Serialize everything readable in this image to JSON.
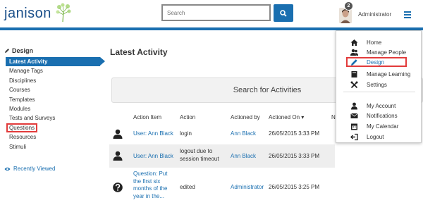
{
  "header": {
    "logo_text": "janison",
    "search_placeholder": "Search",
    "notification_count": "2",
    "user_name": "Administrator"
  },
  "sidebar": {
    "heading": "Design",
    "items": [
      {
        "label": "Latest Activity"
      },
      {
        "label": "Manage Tags"
      },
      {
        "label": "Disciplines"
      },
      {
        "label": "Courses"
      },
      {
        "label": "Templates"
      },
      {
        "label": "Modules"
      },
      {
        "label": "Tests and Surveys"
      },
      {
        "label": "Questions"
      },
      {
        "label": "Resources"
      },
      {
        "label": "Stimuli"
      }
    ],
    "recently_viewed": "Recently Viewed"
  },
  "main": {
    "title": "Latest Activity",
    "search_activities": "Search for Activities",
    "table": {
      "headers": [
        "Action Item",
        "Action",
        "Actioned by",
        "Actioned On ▾",
        "N"
      ],
      "rows": [
        {
          "icon": "user-icon",
          "item": "User: Ann Black",
          "action": "login",
          "by": "Ann Black",
          "on": "26/05/2015 3:33 PM"
        },
        {
          "icon": "user-icon",
          "item": "User: Ann Black",
          "action": "logout due to session timeout",
          "by": "Ann Black",
          "on": "26/05/2015 3:33 PM"
        },
        {
          "icon": "question-icon",
          "item": "Question: Put the first six months of the year in the...",
          "action": "edited",
          "by": "Administrator",
          "on": "26/05/2015 3:25 PM"
        }
      ]
    }
  },
  "menu": {
    "items": [
      {
        "label": "Home",
        "icon": "home-icon"
      },
      {
        "label": "Manage People",
        "icon": "people-icon"
      },
      {
        "label": "Design",
        "icon": "pencil-icon"
      },
      {
        "label": "Manage Learning",
        "icon": "book-icon"
      },
      {
        "label": "Settings",
        "icon": "tools-icon"
      },
      {
        "label": "My Account",
        "icon": "account-icon"
      },
      {
        "label": "Notifications",
        "icon": "envelope-icon"
      },
      {
        "label": "My Calendar",
        "icon": "calendar-icon"
      },
      {
        "label": "Logout",
        "icon": "logout-icon"
      }
    ]
  },
  "colors": {
    "accent": "#1a6fb0",
    "highlight_outline": "#e23b3b"
  }
}
